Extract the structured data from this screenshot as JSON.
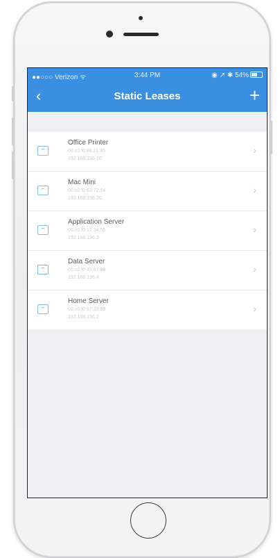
{
  "status_bar": {
    "carrier": "●●○○○ Verizon ᯤ",
    "time": "3:44 PM",
    "right": "◉ ↗ ✱ 54%"
  },
  "nav": {
    "back_icon": "‹",
    "title": "Static Leases",
    "add_icon": "+"
  },
  "leases": [
    {
      "name": "Office Printer",
      "mac": "00:c0:f0:88:21:85",
      "ip": "192.168.196.10"
    },
    {
      "name": "Mac Mini",
      "mac": "00:c0:f0:63:72:54",
      "ip": "192.168.196.20"
    },
    {
      "name": "Application Server",
      "mac": "00:c0:f0:12:34:56",
      "ip": "192.168.196.3"
    },
    {
      "name": "Data Server",
      "mac": "00:c0:f0:45:67:89",
      "ip": "192.168.196.4"
    },
    {
      "name": "Home Server",
      "mac": "00:c0:f0:87:23:89",
      "ip": "192.168.196.2"
    }
  ],
  "chevron": "›",
  "colors": {
    "header": "#3b8fe0",
    "background": "#efeff4",
    "icon": "#7fbdf0"
  }
}
